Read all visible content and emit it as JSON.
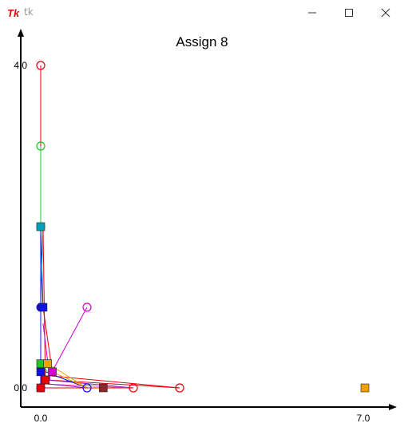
{
  "window": {
    "title": "tk",
    "controls": {
      "minimize": "minimize",
      "maximize": "maximize",
      "close": "close"
    }
  },
  "plot_title": "Assign 8",
  "colors": {
    "red": "#e8000b",
    "green": "#1ec81e",
    "blue": "#1010e8",
    "magenta": "#d000d0",
    "orange": "#f0a000",
    "brown": "#8b2a2a",
    "cyan": "#00a0c0",
    "purple": "#6a2ad0",
    "pink": "#ff40a0"
  },
  "chart_data": {
    "type": "scatter",
    "title": "Assign 8",
    "xlim": [
      0,
      7
    ],
    "ylim": [
      0,
      4
    ],
    "x_tick_labels": [
      "0.0",
      "7.0"
    ],
    "y_tick_labels": [
      "0.0",
      "4.0"
    ],
    "points": [
      {
        "x": 0.0,
        "y": 4.0,
        "color": "red",
        "marker": "circle-open"
      },
      {
        "x": 0.0,
        "y": 3.0,
        "color": "green",
        "marker": "circle-open"
      },
      {
        "x": 0.0,
        "y": 2.0,
        "color": "green",
        "marker": "circle-open"
      },
      {
        "x": 0.0,
        "y": 2.0,
        "color": "cyan",
        "marker": "square"
      },
      {
        "x": 0.0,
        "y": 1.0,
        "color": "blue",
        "marker": "circle"
      },
      {
        "x": 0.05,
        "y": 1.0,
        "color": "blue",
        "marker": "square"
      },
      {
        "x": 1.0,
        "y": 1.0,
        "color": "magenta",
        "marker": "circle-open"
      },
      {
        "x": 0.0,
        "y": 0.3,
        "color": "green",
        "marker": "square"
      },
      {
        "x": 0.15,
        "y": 0.3,
        "color": "orange",
        "marker": "square"
      },
      {
        "x": 0.25,
        "y": 0.2,
        "color": "magenta",
        "marker": "square"
      },
      {
        "x": 0.0,
        "y": 0.2,
        "color": "blue",
        "marker": "square"
      },
      {
        "x": 0.1,
        "y": 0.1,
        "color": "red",
        "marker": "square"
      },
      {
        "x": 0.0,
        "y": 0.0,
        "color": "blue",
        "marker": "circle"
      },
      {
        "x": 0.0,
        "y": 0.0,
        "color": "red",
        "marker": "square"
      },
      {
        "x": 1.0,
        "y": 0.0,
        "color": "blue",
        "marker": "circle-open"
      },
      {
        "x": 1.35,
        "y": 0.0,
        "color": "brown",
        "marker": "square"
      },
      {
        "x": 2.0,
        "y": 0.0,
        "color": "red",
        "marker": "circle-open"
      },
      {
        "x": 3.0,
        "y": 0.0,
        "color": "red",
        "marker": "circle-open"
      },
      {
        "x": 7.0,
        "y": 0.0,
        "color": "orange",
        "marker": "square"
      }
    ],
    "segments": [
      {
        "x1": 0.0,
        "y1": 4.0,
        "x2": 0.0,
        "y2": 2.0,
        "color": "red"
      },
      {
        "x1": 0.0,
        "y1": 3.0,
        "x2": 0.0,
        "y2": 2.0,
        "color": "green"
      },
      {
        "x1": 0.0,
        "y1": 2.0,
        "x2": 0.05,
        "y2": 1.0,
        "color": "blue"
      },
      {
        "x1": 0.05,
        "y1": 2.0,
        "x2": 0.0,
        "y2": 1.0,
        "color": "cyan"
      },
      {
        "x1": 0.05,
        "y1": 2.0,
        "x2": 0.1,
        "y2": 0.1,
        "color": "red"
      },
      {
        "x1": 0.0,
        "y1": 2.0,
        "x2": 0.0,
        "y2": 0.2,
        "color": "blue"
      },
      {
        "x1": 1.0,
        "y1": 1.0,
        "x2": 0.15,
        "y2": 0.1,
        "color": "magenta"
      },
      {
        "x1": 0.05,
        "y1": 1.0,
        "x2": 0.25,
        "y2": 0.2,
        "color": "red"
      },
      {
        "x1": 0.0,
        "y1": 1.0,
        "x2": 0.0,
        "y2": 0.0,
        "color": "blue"
      },
      {
        "x1": 0.05,
        "y1": 0.8,
        "x2": 0.2,
        "y2": 0.1,
        "color": "magenta"
      },
      {
        "x1": 3.0,
        "y1": 0.0,
        "x2": 0.1,
        "y2": 0.1,
        "color": "red"
      },
      {
        "x1": 3.0,
        "y1": 0.0,
        "x2": 0.2,
        "y2": 0.15,
        "color": "red"
      },
      {
        "x1": 2.0,
        "y1": 0.0,
        "x2": 0.1,
        "y2": 0.1,
        "color": "purple"
      },
      {
        "x1": 2.0,
        "y1": 0.0,
        "x2": 0.05,
        "y2": 0.05,
        "color": "pink"
      },
      {
        "x1": 1.0,
        "y1": 0.0,
        "x2": 0.1,
        "y2": 0.2,
        "color": "blue"
      },
      {
        "x1": 1.0,
        "y1": 0.0,
        "x2": 0.15,
        "y2": 0.05,
        "color": "purple"
      },
      {
        "x1": 1.0,
        "y1": 0.0,
        "x2": 0.25,
        "y2": 0.2,
        "color": "orange"
      },
      {
        "x1": 0.0,
        "y1": 0.3,
        "x2": 0.15,
        "y2": 0.2,
        "color": "green"
      },
      {
        "x1": 0.15,
        "y1": 0.3,
        "x2": 1.0,
        "y2": 0.0,
        "color": "orange"
      },
      {
        "x1": 0.0,
        "y1": 0.0,
        "x2": 1.35,
        "y2": 0.0,
        "color": "brown"
      },
      {
        "x1": 0.0,
        "y1": 0.0,
        "x2": 2.0,
        "y2": 0.0,
        "color": "red"
      }
    ]
  }
}
